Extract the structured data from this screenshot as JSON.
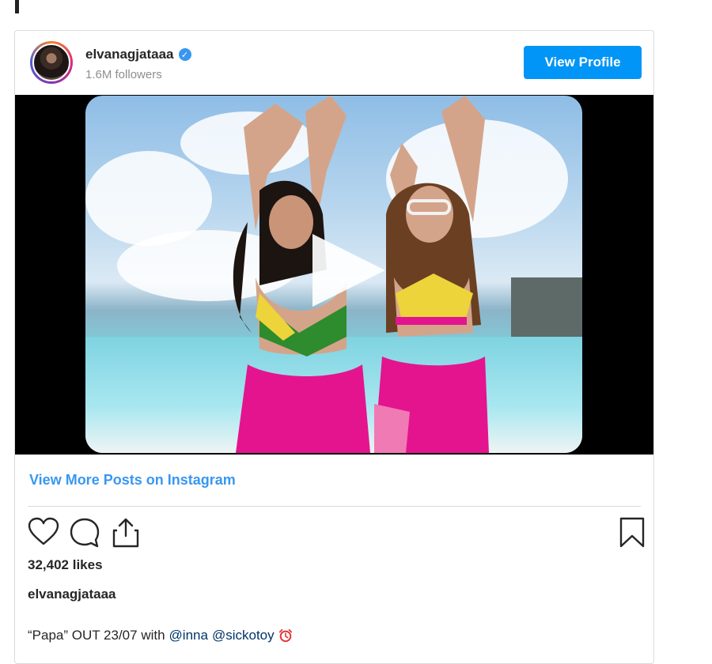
{
  "post": {
    "username": "elvanagjataaa",
    "followers": "1.6M followers",
    "view_profile_label": "View Profile",
    "more_posts_label": "View More Posts on Instagram",
    "likes": "32,402 likes",
    "caption_username": "elvanagjataaa",
    "caption_text": "“Papa” OUT 23/07 with",
    "mention_1": "@inna",
    "mention_2": "@sickotoy"
  },
  "icons": {
    "verified": "verified-badge-icon",
    "play": "play-icon",
    "like": "heart-icon",
    "comment": "comment-icon",
    "share": "share-icon",
    "save": "bookmark-icon",
    "emoji": "alarm-clock-icon"
  },
  "colors": {
    "accent": "#3897f0",
    "button": "#0095f6",
    "text": "#262626",
    "muted": "#8e8e8e"
  }
}
